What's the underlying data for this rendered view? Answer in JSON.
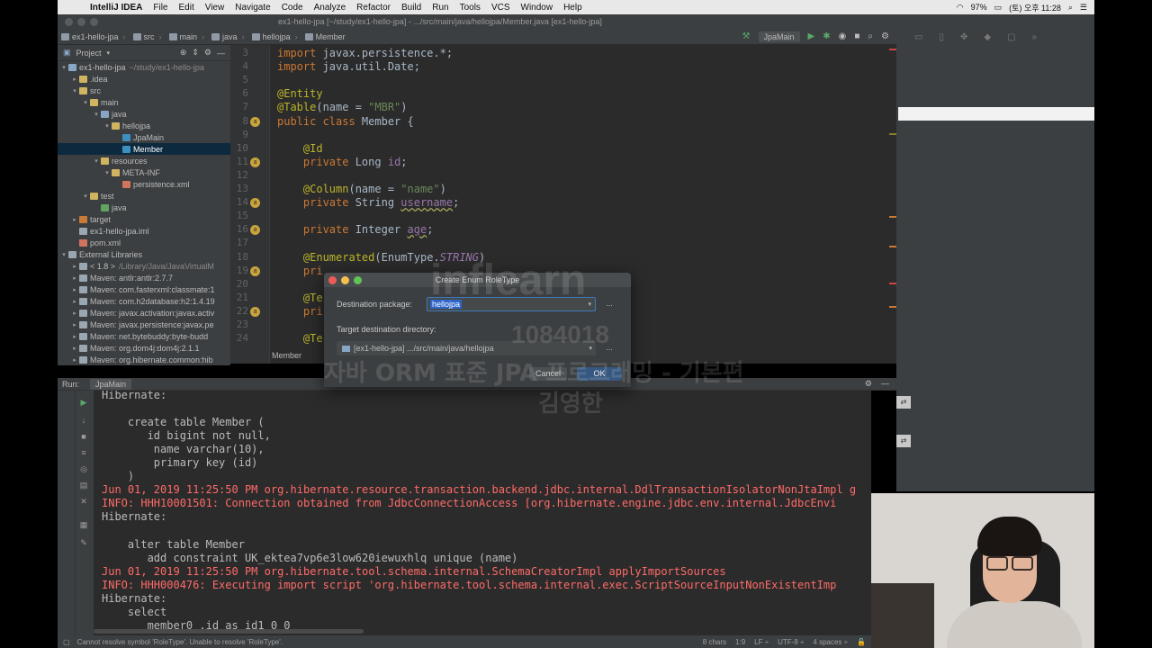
{
  "menubar": {
    "app": "IntelliJ IDEA",
    "items": [
      "File",
      "Edit",
      "View",
      "Navigate",
      "Code",
      "Analyze",
      "Refactor",
      "Build",
      "Run",
      "Tools",
      "VCS",
      "Window",
      "Help"
    ],
    "battery": "97%",
    "clock": "(토) 오후 11:28"
  },
  "window": {
    "title": "ex1-hello-jpa [~/study/ex1-hello-jpa] - .../src/main/java/hellojpa/Member.java [ex1-hello-jpa]"
  },
  "breadcrumbs": [
    "ex1-hello-jpa",
    "src",
    "main",
    "java",
    "hellojpa",
    "Member"
  ],
  "toolbar": {
    "run_config": "JpaMain"
  },
  "project": {
    "header": "Project",
    "tree": [
      {
        "label": "ex1-hello-jpa",
        "hint": "~/study/ex1-hello-jpa",
        "indent": 0,
        "arrow": "▾",
        "icon": "f-blue"
      },
      {
        "label": ".idea",
        "indent": 1,
        "arrow": "▸",
        "icon": "f-folder"
      },
      {
        "label": "src",
        "indent": 1,
        "arrow": "▾",
        "icon": "f-folder"
      },
      {
        "label": "main",
        "indent": 2,
        "arrow": "▾",
        "icon": "f-folder"
      },
      {
        "label": "java",
        "indent": 3,
        "arrow": "▾",
        "icon": "f-blue"
      },
      {
        "label": "hellojpa",
        "indent": 4,
        "arrow": "▾",
        "icon": "f-folder"
      },
      {
        "label": "JpaMain",
        "indent": 5,
        "arrow": "",
        "icon": "f-cls"
      },
      {
        "label": "Member",
        "indent": 5,
        "arrow": "",
        "icon": "f-cls",
        "selected": true
      },
      {
        "label": "resources",
        "indent": 3,
        "arrow": "▾",
        "icon": "f-folder"
      },
      {
        "label": "META-INF",
        "indent": 4,
        "arrow": "▾",
        "icon": "f-folder"
      },
      {
        "label": "persistence.xml",
        "indent": 5,
        "arrow": "",
        "icon": "f-xml"
      },
      {
        "label": "test",
        "indent": 2,
        "arrow": "▾",
        "icon": "f-folder"
      },
      {
        "label": "java",
        "indent": 3,
        "arrow": "",
        "icon": "f-green"
      },
      {
        "label": "target",
        "indent": 1,
        "arrow": "▸",
        "icon": "f-orange"
      },
      {
        "label": "ex1-hello-jpa.iml",
        "indent": 1,
        "arrow": "",
        "icon": "f-lib"
      },
      {
        "label": "pom.xml",
        "indent": 1,
        "arrow": "",
        "icon": "f-xml"
      },
      {
        "label": "External Libraries",
        "indent": 0,
        "arrow": "▾",
        "icon": "f-lib"
      },
      {
        "label": "< 1.8 >",
        "hint": "/Library/Java/JavaVirtualM",
        "indent": 1,
        "arrow": "▸",
        "icon": "f-lib"
      },
      {
        "label": "Maven: antlr:antlr:2.7.7",
        "indent": 1,
        "arrow": "▸",
        "icon": "f-lib"
      },
      {
        "label": "Maven: com.fasterxml:classmate:1",
        "indent": 1,
        "arrow": "▸",
        "icon": "f-lib"
      },
      {
        "label": "Maven: com.h2database:h2:1.4.19",
        "indent": 1,
        "arrow": "▸",
        "icon": "f-lib"
      },
      {
        "label": "Maven: javax.activation:javax.activ",
        "indent": 1,
        "arrow": "▸",
        "icon": "f-lib"
      },
      {
        "label": "Maven: javax.persistence:javax.pe",
        "indent": 1,
        "arrow": "▸",
        "icon": "f-lib"
      },
      {
        "label": "Maven: net.bytebuddy:byte-budd",
        "indent": 1,
        "arrow": "▸",
        "icon": "f-lib"
      },
      {
        "label": "Maven: org.dom4j:dom4j:2.1.1",
        "indent": 1,
        "arrow": "▸",
        "icon": "f-lib"
      },
      {
        "label": "Maven: org.hibernate.common:hib",
        "indent": 1,
        "arrow": "▸",
        "icon": "f-lib"
      }
    ]
  },
  "editor": {
    "tab": "Member",
    "lines": [
      {
        "n": "3",
        "html": "<span class='kw'>import</span> javax.persistence.*;"
      },
      {
        "n": "4",
        "html": "<span class='kw'>import</span> java.util.Date;"
      },
      {
        "n": "5",
        "html": ""
      },
      {
        "n": "6",
        "html": "<span class='an'>@Entity</span>"
      },
      {
        "n": "7",
        "html": "<span class='an'>@Table</span>(name = <span class='st'>\"MBR\"</span>)"
      },
      {
        "n": "8",
        "html": "<span class='kw'>public class</span> Member {"
      },
      {
        "n": "9",
        "html": ""
      },
      {
        "n": "10",
        "html": "    <span class='an'>@Id</span>"
      },
      {
        "n": "11",
        "html": "    <span class='kw'>private</span> Long <span class='fd'>id</span>;"
      },
      {
        "n": "12",
        "html": ""
      },
      {
        "n": "13",
        "html": "    <span class='an'>@Column</span>(name = <span class='st'>\"name\"</span>)"
      },
      {
        "n": "14",
        "html": "    <span class='kw'>private</span> String <span class='fd ul'>username</span>;"
      },
      {
        "n": "15",
        "html": ""
      },
      {
        "n": "16",
        "html": "    <span class='kw'>private</span> Integer <span class='fd ul'>age</span>;"
      },
      {
        "n": "17",
        "html": ""
      },
      {
        "n": "18",
        "html": "    <span class='an'>@Enumerated</span>(EnumType.<span class='en'>STRING</span>)"
      },
      {
        "n": "19",
        "html": "    <span class='kw'>pri</span>"
      },
      {
        "n": "20",
        "html": ""
      },
      {
        "n": "21",
        "html": "    <span class='an'>@Te</span>"
      },
      {
        "n": "22",
        "html": "    <span class='kw'>pri</span>"
      },
      {
        "n": "23",
        "html": ""
      },
      {
        "n": "24",
        "html": "    <span class='an'>@Te</span>"
      }
    ]
  },
  "run": {
    "label": "Run:",
    "tab": "JpaMain",
    "lines": [
      {
        "text": "Hibernate:",
        "red": false
      },
      {
        "text": "",
        "red": false
      },
      {
        "text": "    create table Member (",
        "red": false
      },
      {
        "text": "       id bigint not null,",
        "red": false
      },
      {
        "text": "        name varchar(10),",
        "red": false
      },
      {
        "text": "        primary key (id)",
        "red": false
      },
      {
        "text": "    )",
        "red": false
      },
      {
        "text": "Jun 01, 2019 11:25:50 PM org.hibernate.resource.transaction.backend.jdbc.internal.DdlTransactionIsolatorNonJtaImpl g",
        "red": true
      },
      {
        "text": "INFO: HHH10001501: Connection obtained from JdbcConnectionAccess [org.hibernate.engine.jdbc.env.internal.JdbcEnvi",
        "red": true
      },
      {
        "text": "Hibernate:",
        "red": false
      },
      {
        "text": "",
        "red": false
      },
      {
        "text": "    alter table Member",
        "red": false
      },
      {
        "text": "       add constraint UK_ektea7vp6e3low620iewuxhlq unique (name)",
        "red": false
      },
      {
        "text": "Jun 01, 2019 11:25:50 PM org.hibernate.tool.schema.internal.SchemaCreatorImpl applyImportSources",
        "red": true
      },
      {
        "text": "INFO: HHH000476: Executing import script 'org.hibernate.tool.schema.internal.exec.ScriptSourceInputNonExistentImp",
        "red": true
      },
      {
        "text": "Hibernate:",
        "red": false
      },
      {
        "text": "    select",
        "red": false
      },
      {
        "text": "       member0_.id as id1_0_0_",
        "red": false
      }
    ]
  },
  "status": {
    "message": "Cannot resolve symbol 'RoleType'. Unable to resolve 'RoleType'.",
    "chars": "8 chars",
    "position": "1:9",
    "line_sep": "LF ÷",
    "encoding": "UTF-8 ÷",
    "indent": "4 spaces ÷"
  },
  "dialog": {
    "title": "Create Enum RoleType",
    "dest_pkg_label": "Destination package:",
    "dest_pkg_value": "hellojpa",
    "target_dir_label": "Target destination directory:",
    "target_dir_value": "[ex1-hello-jpa] .../src/main/java/hellojpa",
    "cancel": "Cancel",
    "ok": "OK",
    "dots": "..."
  },
  "watermark": {
    "brand": "inflearn",
    "id": "1084018",
    "course": "자바 ORM 표준 JPA 프로그래밍 - 기본편",
    "author": "김영한"
  },
  "colors": {
    "ide_bg": "#2b2b2b",
    "panel_bg": "#3c3f41",
    "keyword": "#cc7832",
    "annotation": "#bbb529",
    "string": "#6a8759",
    "error_text": "#ff6b68",
    "ok_button": "#365880"
  }
}
